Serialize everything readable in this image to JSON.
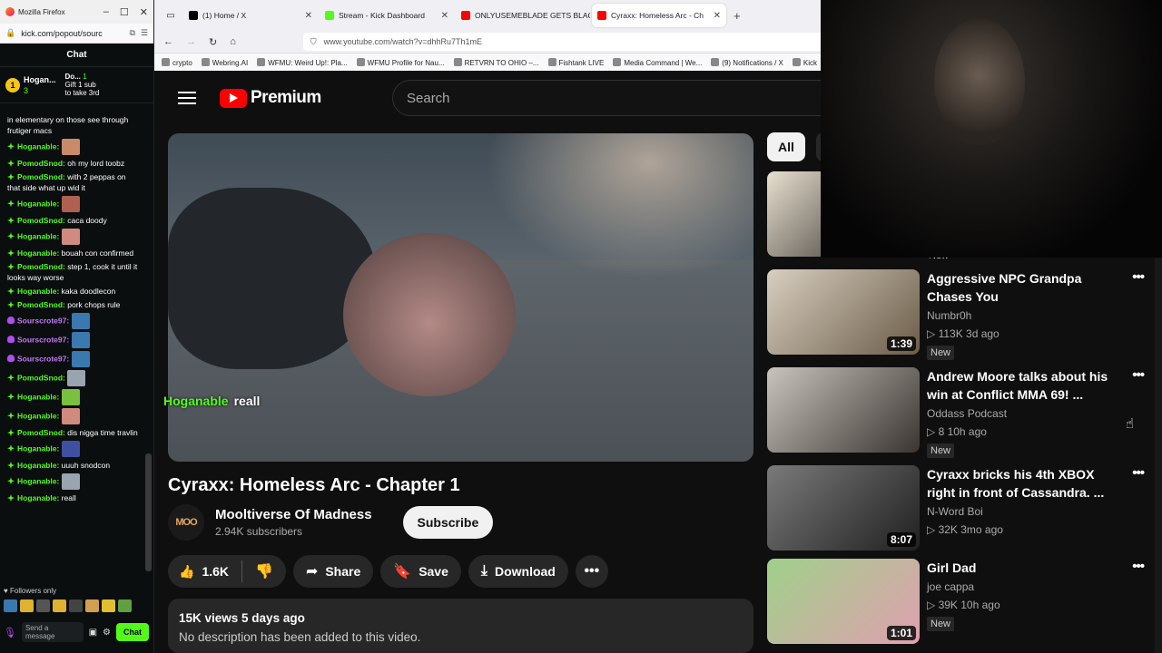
{
  "kick": {
    "window_title": "Mozilla Firefox",
    "url": "kick.com/popout/sourc",
    "header": "Chat",
    "pinned": {
      "rank": "1",
      "name": "Hogan...",
      "count": "3",
      "second_name": "Do...",
      "second_rank": "1",
      "gift_text_1": "Gift 1 sub",
      "gift_text_2": "to take 3rd"
    },
    "messages": [
      {
        "user": "",
        "text": "in elementary on those see through frutiger macs",
        "color": "none",
        "emote": false
      },
      {
        "user": "Hoganable:",
        "text": "",
        "color": "green",
        "emote": true,
        "emote_color": "#c98a6a"
      },
      {
        "user": "PomodSnod:",
        "text": "oh my lord toobz",
        "color": "green",
        "emote": false
      },
      {
        "user": "PomodSnod:",
        "text": "with 2 peppas on that side what up wid it",
        "color": "green",
        "emote": false
      },
      {
        "user": "Hoganable:",
        "text": "",
        "color": "green",
        "emote": true,
        "emote_color": "#b06050"
      },
      {
        "user": "PomodSnod:",
        "text": "caca doody",
        "color": "green",
        "emote": false
      },
      {
        "user": "Hoganable:",
        "text": "",
        "color": "green",
        "emote": true,
        "emote_color": "#d08a80"
      },
      {
        "user": "Hoganable:",
        "text": "bouah con confirmed",
        "color": "green",
        "emote": false
      },
      {
        "user": "PomodSnod:",
        "text": "step 1, cook it until it looks way worse",
        "color": "green",
        "emote": false
      },
      {
        "user": "Hoganable:",
        "text": "kaka doodlecon",
        "color": "green",
        "emote": false
      },
      {
        "user": "PomodSnod:",
        "text": "pork chops rule",
        "color": "green",
        "emote": false
      },
      {
        "user": "Sourscrote97:",
        "text": "",
        "color": "purple",
        "emote": true,
        "emote_color": "#3a78b0"
      },
      {
        "user": "Sourscrote97:",
        "text": "",
        "color": "purple",
        "emote": true,
        "emote_color": "#3a78b0"
      },
      {
        "user": "Sourscrote97:",
        "text": "",
        "color": "purple",
        "emote": true,
        "emote_color": "#3a78b0"
      },
      {
        "user": "PomodSnod:",
        "text": "",
        "color": "green",
        "emote": true,
        "emote_color": "#9aa4b0"
      },
      {
        "user": "Hoganable:",
        "text": "",
        "color": "green",
        "emote": true,
        "emote_color": "#7ac040"
      },
      {
        "user": "Hoganable:",
        "text": "",
        "color": "green",
        "emote": true,
        "emote_color": "#d08a80"
      },
      {
        "user": "PomodSnod:",
        "text": "dis nigga time travlin",
        "color": "green",
        "emote": false
      },
      {
        "user": "Hoganable:",
        "text": "",
        "color": "green",
        "emote": true,
        "emote_color": "#4050a0"
      },
      {
        "user": "Hoganable:",
        "text": "uuuh snodcon",
        "color": "green",
        "emote": false
      },
      {
        "user": "Hoganable:",
        "text": "",
        "color": "green",
        "emote": true,
        "emote_color": "#9aa4b0"
      },
      {
        "user": "Hoganable:",
        "text": "reall",
        "color": "green",
        "emote": false
      }
    ],
    "followers_only": "Followers only",
    "input_placeholder": "Send a message",
    "chat_button": "Chat"
  },
  "browser": {
    "tabs": [
      {
        "label": "(1) Home / X",
        "icon_color": "#000000",
        "active": false
      },
      {
        "label": "Stream - Kick Dashboard",
        "icon_color": "#53fc18",
        "active": false
      },
      {
        "label": "ONLYUSEMEBLADE GETS BLACK",
        "icon_color": "#ff0000",
        "active": false
      },
      {
        "label": "Cyraxx: Homeless Arc - Ch",
        "icon_color": "#ff0000",
        "active": true
      }
    ],
    "url": "www.youtube.com/watch?v=dhhRu7Th1mE",
    "bookmarks": [
      "crypto",
      "Webring.AI",
      "WFMU: Weird Up!: Pla...",
      "WFMU Profile for Nau...",
      "RETVRN TO OHIO –...",
      "Fishtank LIVE",
      "Media Command | We...",
      "(9) Notifications / X",
      "Kick"
    ]
  },
  "youtube": {
    "logo_text": "Premium",
    "search_placeholder": "Search",
    "overlay": {
      "user": "Hoganable",
      "text": "reall"
    },
    "video_title": "Cyraxx: Homeless Arc - Chapter 1",
    "channel_name": "Mooltiverse Of Madness",
    "channel_avatar": "MOO",
    "subscribers": "2.94K subscribers",
    "subscribe_label": "Subscribe",
    "likes": "1.6K",
    "share_label": "Share",
    "save_label": "Save",
    "download_label": "Download",
    "description": {
      "meta": "15K views  5 days ago",
      "text": "No description has been added to this video."
    },
    "chips": [
      "All"
    ],
    "top_new_badge": "New",
    "recommendations": [
      {
        "title": "Aggressive NPC Grandpa Chases You",
        "channel": "Numbr0h",
        "meta": "▷ 113K  3d ago",
        "duration": "1:39",
        "badge": "New",
        "thumb_color_a": "#d8cfc0",
        "thumb_color_b": "#6b5c48"
      },
      {
        "title": "Andrew Moore talks about his win at Conflict MMA 69! ...",
        "channel": "Oddass Podcast",
        "meta": "▷ 8  10h ago",
        "duration": "",
        "badge": "New",
        "thumb_color_a": "#c9c4bd",
        "thumb_color_b": "#3a3530"
      },
      {
        "title": "Cyraxx bricks his 4th XBOX right in front of Cassandra. ...",
        "channel": "N-Word Boi",
        "meta": "▷ 32K  3mo ago",
        "duration": "8:07",
        "badge": "",
        "thumb_color_a": "#7a7a7a",
        "thumb_color_b": "#202020"
      },
      {
        "title": "Girl Dad",
        "channel": "joe cappa",
        "meta": "▷ 39K  10h ago",
        "duration": "1:01",
        "badge": "New",
        "thumb_color_a": "#9fd08a",
        "thumb_color_b": "#e0a0b0"
      }
    ]
  }
}
